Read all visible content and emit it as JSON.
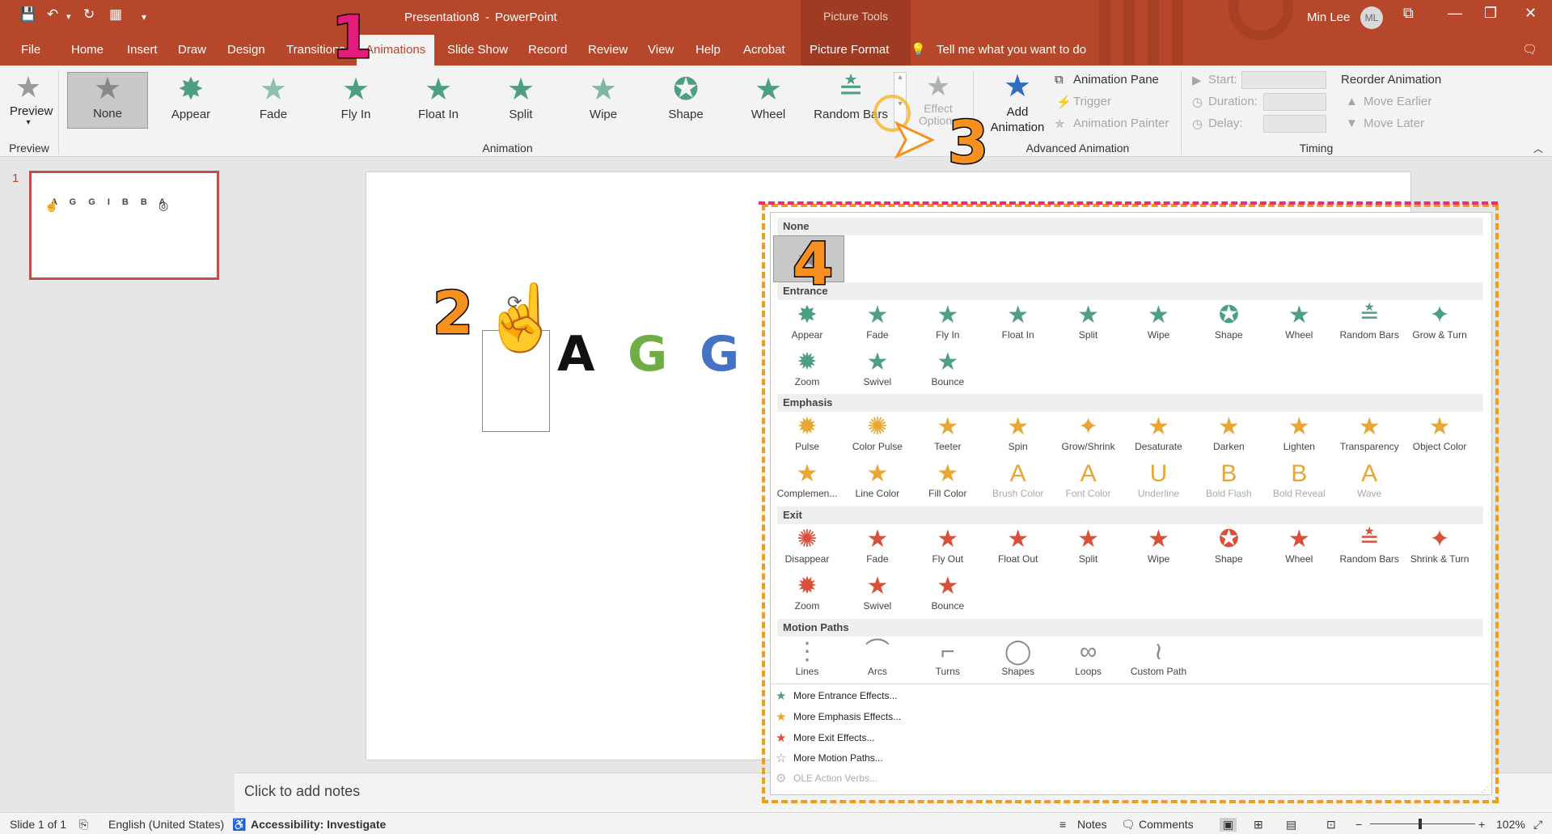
{
  "title_bar": {
    "document": "Presentation8",
    "separator": "-",
    "app": "PowerPoint",
    "context_group": "Picture Tools",
    "user_name": "Min Lee",
    "user_initials": "ML",
    "tell_me": "Tell me what you want to do"
  },
  "tabs": [
    "File",
    "Home",
    "Insert",
    "Draw",
    "Design",
    "Transitions",
    "Animations",
    "Slide Show",
    "Record",
    "Review",
    "View",
    "Help",
    "Acrobat",
    "Picture Format"
  ],
  "ribbon": {
    "preview_label": "Preview",
    "preview_group": "Preview",
    "animation_group": "Animation",
    "gallery": [
      "None",
      "Appear",
      "Fade",
      "Fly In",
      "Float In",
      "Split",
      "Wipe",
      "Shape",
      "Wheel",
      "Random Bars"
    ],
    "effect_options": "Effect Options",
    "add_animation": "Add Animation",
    "animation_pane": "Animation Pane",
    "trigger": "Trigger",
    "animation_painter": "Animation Painter",
    "advanced_group": "Advanced Animation",
    "start": "Start:",
    "duration": "Duration:",
    "delay": "Delay:",
    "reorder": "Reorder Animation",
    "move_earlier": "Move Earlier",
    "move_later": "Move Later",
    "timing_group": "Timing"
  },
  "slide_number": "1",
  "slide_letters": [
    "A",
    "G",
    "G"
  ],
  "thumb_letters": "A G G I B B A",
  "annotations": [
    "1",
    "2",
    "3",
    "4"
  ],
  "notes_placeholder": "Click to add notes",
  "dropdown": {
    "sections": {
      "none": "None",
      "entrance": "Entrance",
      "emphasis": "Emphasis",
      "exit": "Exit",
      "motion": "Motion Paths"
    },
    "entrance": [
      "Appear",
      "Fade",
      "Fly In",
      "Float In",
      "Split",
      "Wipe",
      "Shape",
      "Wheel",
      "Random Bars",
      "Grow & Turn",
      "Zoom",
      "Swivel",
      "Bounce"
    ],
    "emphasis": [
      "Pulse",
      "Color Pulse",
      "Teeter",
      "Spin",
      "Grow/Shrink",
      "Desaturate",
      "Darken",
      "Lighten",
      "Transparency",
      "Object Color",
      "Complemen...",
      "Line Color",
      "Fill Color",
      "Brush Color",
      "Font Color",
      "Underline",
      "Bold Flash",
      "Bold Reveal",
      "Wave"
    ],
    "exit": [
      "Disappear",
      "Fade",
      "Fly Out",
      "Float Out",
      "Split",
      "Wipe",
      "Shape",
      "Wheel",
      "Random Bars",
      "Shrink & Turn",
      "Zoom",
      "Swivel",
      "Bounce"
    ],
    "motion": [
      "Lines",
      "Arcs",
      "Turns",
      "Shapes",
      "Loops",
      "Custom Path"
    ],
    "more": [
      "More Entrance Effects...",
      "More Emphasis Effects...",
      "More Exit Effects...",
      "More Motion Paths...",
      "OLE Action Verbs..."
    ]
  },
  "status": {
    "slide": "Slide 1 of 1",
    "language": "English (United States)",
    "accessibility": "Accessibility: Investigate",
    "notes": "Notes",
    "comments": "Comments",
    "zoom": "102%"
  },
  "colors": {
    "brand": "#b7472a",
    "entrance": "#4e9e86",
    "emphasis": "#e8a735",
    "exit": "#d9503a",
    "dash_pink": "#ee2a7b",
    "dash_orange": "#f39c12"
  }
}
